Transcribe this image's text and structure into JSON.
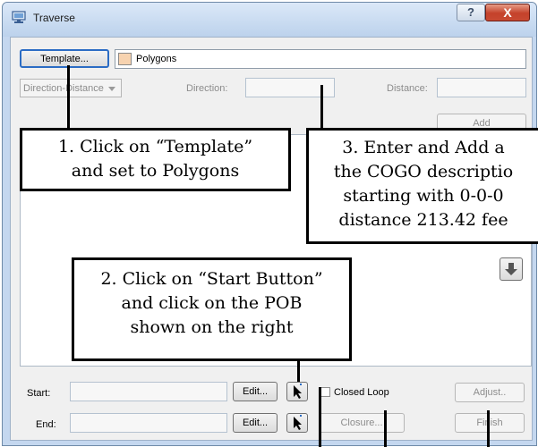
{
  "window": {
    "title": "Traverse",
    "help_label": "?",
    "close_label": "X"
  },
  "template": {
    "button_label": "Template...",
    "name": "Polygons",
    "swatch_color": "#f7d3b0"
  },
  "input_mode": {
    "selected": "Direction-Distance"
  },
  "direction": {
    "label": "Direction:",
    "value": ""
  },
  "distance": {
    "label": "Distance:",
    "value": ""
  },
  "add_button": {
    "label": "Add"
  },
  "start": {
    "label": "Start:",
    "value": "",
    "edit_label": "Edit..."
  },
  "end": {
    "label": "End:",
    "value": "",
    "edit_label": "Edit..."
  },
  "closed_loop": {
    "label": "Closed Loop",
    "checked": false
  },
  "buttons": {
    "adjust": "Adjust..",
    "closure": "Closure...",
    "finish": "Finish"
  },
  "callouts": {
    "one": {
      "line1": "1. Click on “Template”",
      "line2": "and set to Polygons"
    },
    "two": {
      "line1": "2. Click on “Start Button”",
      "line2": "and click on the POB",
      "line3": "shown on the right"
    },
    "three": {
      "line1": "3. Enter and Add a",
      "line2": "the COGO descriptio",
      "line3": "starting with 0-0-0",
      "line4": "distance 213.42 fee"
    }
  }
}
